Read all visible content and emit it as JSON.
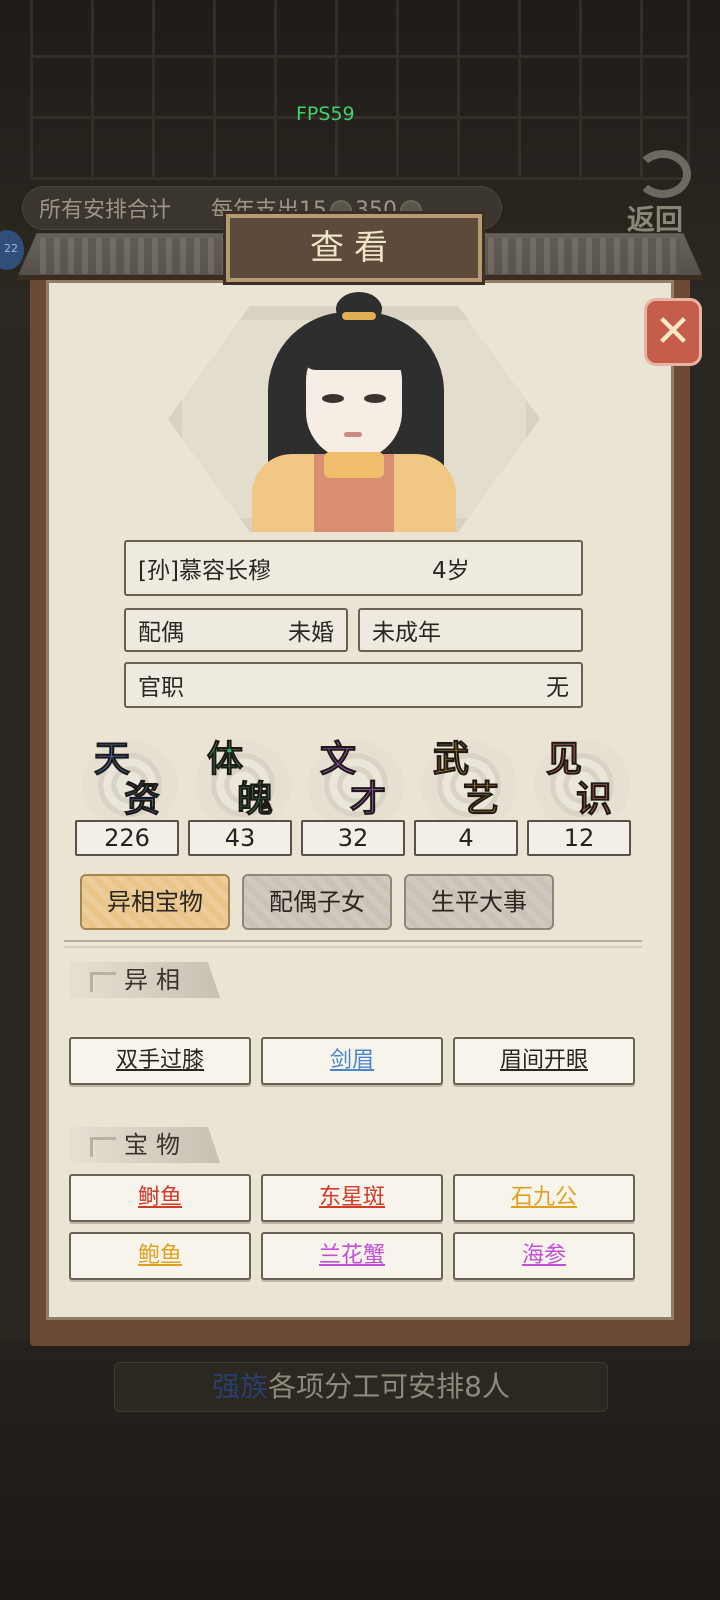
{
  "status": {
    "fps": "FPS59"
  },
  "summary": {
    "label": "所有安排合计",
    "annual_cost_label": "每年支出",
    "cost_value": "15",
    "coins": "350"
  },
  "back": {
    "label": "返回"
  },
  "side_badge": "22",
  "dialog": {
    "title": "查看",
    "close_icon": "close-x-icon"
  },
  "person": {
    "name": "[孙]慕容长穆",
    "age": "4岁",
    "spouse_label": "配偶",
    "spouse_value": "未婚",
    "adult_status": "未成年",
    "office_label": "官职",
    "office_value": "无"
  },
  "stats": [
    {
      "c1": "天",
      "c2": "资",
      "value": "226",
      "color": "#3e7fd8"
    },
    {
      "c1": "体",
      "c2": "魄",
      "value": "43",
      "color": "#35b86a"
    },
    {
      "c1": "文",
      "c2": "才",
      "value": "32",
      "color": "#b25fd6"
    },
    {
      "c1": "武",
      "c2": "艺",
      "value": "4",
      "color": "#e3a02a"
    },
    {
      "c1": "见",
      "c2": "识",
      "value": "12",
      "color": "#e57566"
    }
  ],
  "tabs": [
    {
      "label": "异相宝物",
      "active": true
    },
    {
      "label": "配偶子女",
      "active": false
    },
    {
      "label": "生平大事",
      "active": false
    }
  ],
  "traits": {
    "heading": "异相",
    "items": [
      {
        "label": "双手过膝",
        "color": "#2b2620"
      },
      {
        "label": "剑眉",
        "color": "#4a86c8"
      },
      {
        "label": "眉间开眼",
        "color": "#2b2620"
      }
    ]
  },
  "treasures": {
    "heading": "宝物",
    "items": [
      {
        "label": "鲥鱼",
        "color": "#d23a2a"
      },
      {
        "label": "东星斑",
        "color": "#d23a2a"
      },
      {
        "label": "石九公",
        "color": "#e0a020"
      },
      {
        "label": "鲍鱼",
        "color": "#e0a020"
      },
      {
        "label": "兰花蟹",
        "color": "#c24fd6"
      },
      {
        "label": "海参",
        "color": "#c24fd6"
      }
    ]
  },
  "footer": {
    "highlight": "强族",
    "text": "各项分工可安排8人"
  }
}
